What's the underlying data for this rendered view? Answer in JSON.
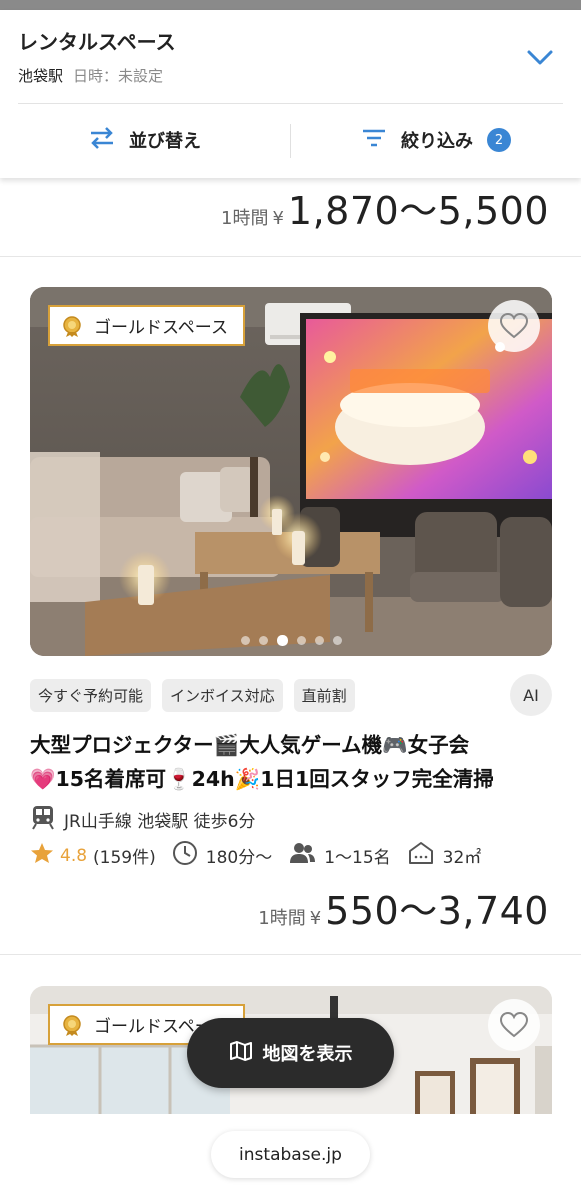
{
  "header": {
    "title": "レンタルスペース",
    "location": "池袋駅",
    "datetime": "日時：未設定",
    "sort_label": "並び替え",
    "filter_label": "絞り込み",
    "filter_count": "2"
  },
  "prev_listing": {
    "price_unit": "1時間",
    "yen": "¥",
    "price_range": "1,870～5,500"
  },
  "listing": {
    "badge": "ゴールドスペース",
    "tags": [
      "今すぐ予約可能",
      "インボイス対応",
      "直前割"
    ],
    "ai_label": "AI",
    "title_line1": "大型プロジェクター🎬大人気ゲーム機🎮女子会",
    "title_line2": "💗15名着席可🍷24h🎉1日1回スタッフ完全清掃",
    "station": "JR山手線 池袋駅 徒歩6分",
    "rating": "4.8",
    "review_count": "(159件)",
    "min_time": "180分～",
    "capacity": "1～15名",
    "area": "32㎡",
    "price_unit": "1時間",
    "yen": "¥",
    "price_range": "550～3,740",
    "carousel_total": 6,
    "carousel_active": 3
  },
  "next_listing": {
    "badge": "ゴールドスペース"
  },
  "map_button": "地図を表示",
  "url": "instabase.jp",
  "colors": {
    "accent": "#3a86d4",
    "gold": "#d7a13a",
    "star": "#e8a23a",
    "fab": "#2b2b2b"
  }
}
